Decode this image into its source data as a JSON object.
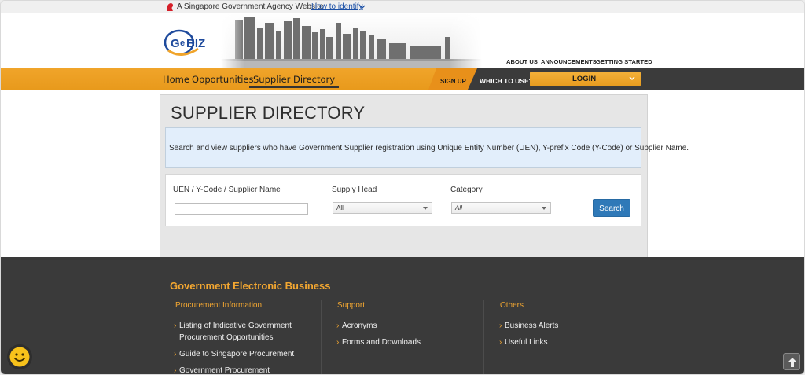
{
  "gov_bar": {
    "text": "A Singapore Government Agency Website",
    "link": "How to identify"
  },
  "header": {
    "logo_text": "GeBIZ",
    "top_links": [
      "ABOUT US",
      "ANNOUNCEMENTS",
      "GETTING STARTED"
    ]
  },
  "nav": {
    "items": [
      "Home",
      "Opportunities",
      "Supplier Directory"
    ],
    "active": "Supplier Directory",
    "signup": "SIGN UP",
    "which_to_use": "WHICH TO USE?",
    "login": "LOGIN"
  },
  "main": {
    "title": "SUPPLIER DIRECTORY",
    "info": "Search and view suppliers who have Government Supplier registration using Unique Entity Number (UEN), Y-prefix Code (Y-Code) or Supplier Name.",
    "fields": {
      "uen_label": "UEN / Y-Code / Supplier Name",
      "uen_value": "",
      "supply_head_label": "Supply Head",
      "supply_head_value": "All",
      "category_label": "Category",
      "category_value": "All"
    },
    "search_button": "Search"
  },
  "footer": {
    "title": "Government Electronic Business",
    "columns": [
      {
        "heading": "Procurement Information",
        "items": [
          "Listing of Indicative Government",
          "Procurement Opportunities",
          "Guide to Singapore Procurement",
          "Government Procurement"
        ]
      },
      {
        "heading": "Support",
        "items": [
          "Acronyms",
          "Forms and Downloads"
        ]
      },
      {
        "heading": "Others",
        "items": [
          "Business Alerts",
          "Useful Links"
        ]
      }
    ],
    "bullet": "›"
  },
  "colors": {
    "accent_orange": "#f0a42a",
    "dark_bar": "#3b3b3b",
    "footer_bg": "#3a3a3a",
    "search_blue": "#2f79b8",
    "info_bg": "#e2eefb"
  }
}
